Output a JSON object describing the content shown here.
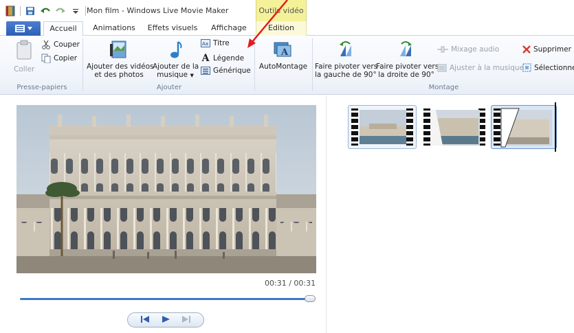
{
  "window": {
    "title": "Mon film - Windows Live Movie Maker",
    "context_tab_header": "Outils vidéo"
  },
  "tabs": [
    {
      "label": "Accueil"
    },
    {
      "label": "Animations"
    },
    {
      "label": "Effets visuels"
    },
    {
      "label": "Affichage"
    },
    {
      "label": "Edition"
    }
  ],
  "ribbon": {
    "clipboard": {
      "paste": "Coller",
      "cut": "Couper",
      "copy": "Copier",
      "group_label": "Presse-papiers"
    },
    "add": {
      "add_videos_line1": "Ajouter des vidéos",
      "add_videos_line2": "et des photos",
      "add_music_line1": "Ajouter de la",
      "add_music_line2": "musique",
      "title": "Titre",
      "caption": "Légende",
      "credits": "Générique",
      "group_label": "Ajouter"
    },
    "automovie": "AutoMontage",
    "edit": {
      "rotate_left_line1": "Faire pivoter vers",
      "rotate_left_line2": "la gauche de 90°",
      "rotate_right_line1": "Faire pivoter vers",
      "rotate_right_line2": "la droite de 90°",
      "audio_mix": "Mixage audio",
      "fit_music": "Ajuster à la musique",
      "delete": "Supprimer",
      "select": "Sélectionne",
      "group_label": "Montage"
    }
  },
  "preview": {
    "time": "00:31 / 00:31",
    "seek_position": 1.0
  },
  "storyboard": {
    "clips": [
      {
        "selected": false
      },
      {
        "selected": false
      },
      {
        "selected": true
      }
    ]
  },
  "colors": {
    "accent": "#2c5fb5",
    "context_tab": "#f4f199",
    "annotation_arrow": "#e31b1b"
  }
}
